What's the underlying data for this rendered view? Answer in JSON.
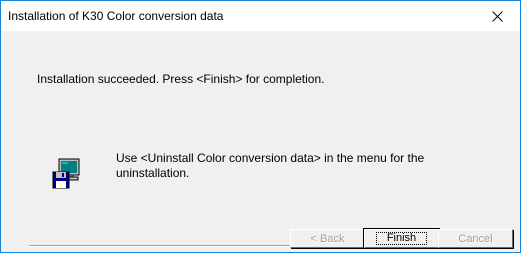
{
  "window": {
    "title": "Installation of K30 Color conversion data",
    "close_glyph": "✕"
  },
  "message": {
    "success": "Installation succeeded.  Press <Finish> for completion.",
    "uninstall_hint": "Use <Uninstall Color conversion data> in the menu for the uninstallation."
  },
  "icons": {
    "setup": "computer-floppy-icon",
    "close": "close-icon"
  },
  "buttons": {
    "back": {
      "label": "< Back",
      "enabled": false
    },
    "finish": {
      "label": "Finish",
      "enabled": true,
      "default": true
    },
    "cancel": {
      "label": "Cancel",
      "enabled": false
    }
  },
  "colors": {
    "window_border": "#1883d7",
    "dialog_face": "#f0f0f0",
    "disabled_text": "#a0a0a0"
  }
}
